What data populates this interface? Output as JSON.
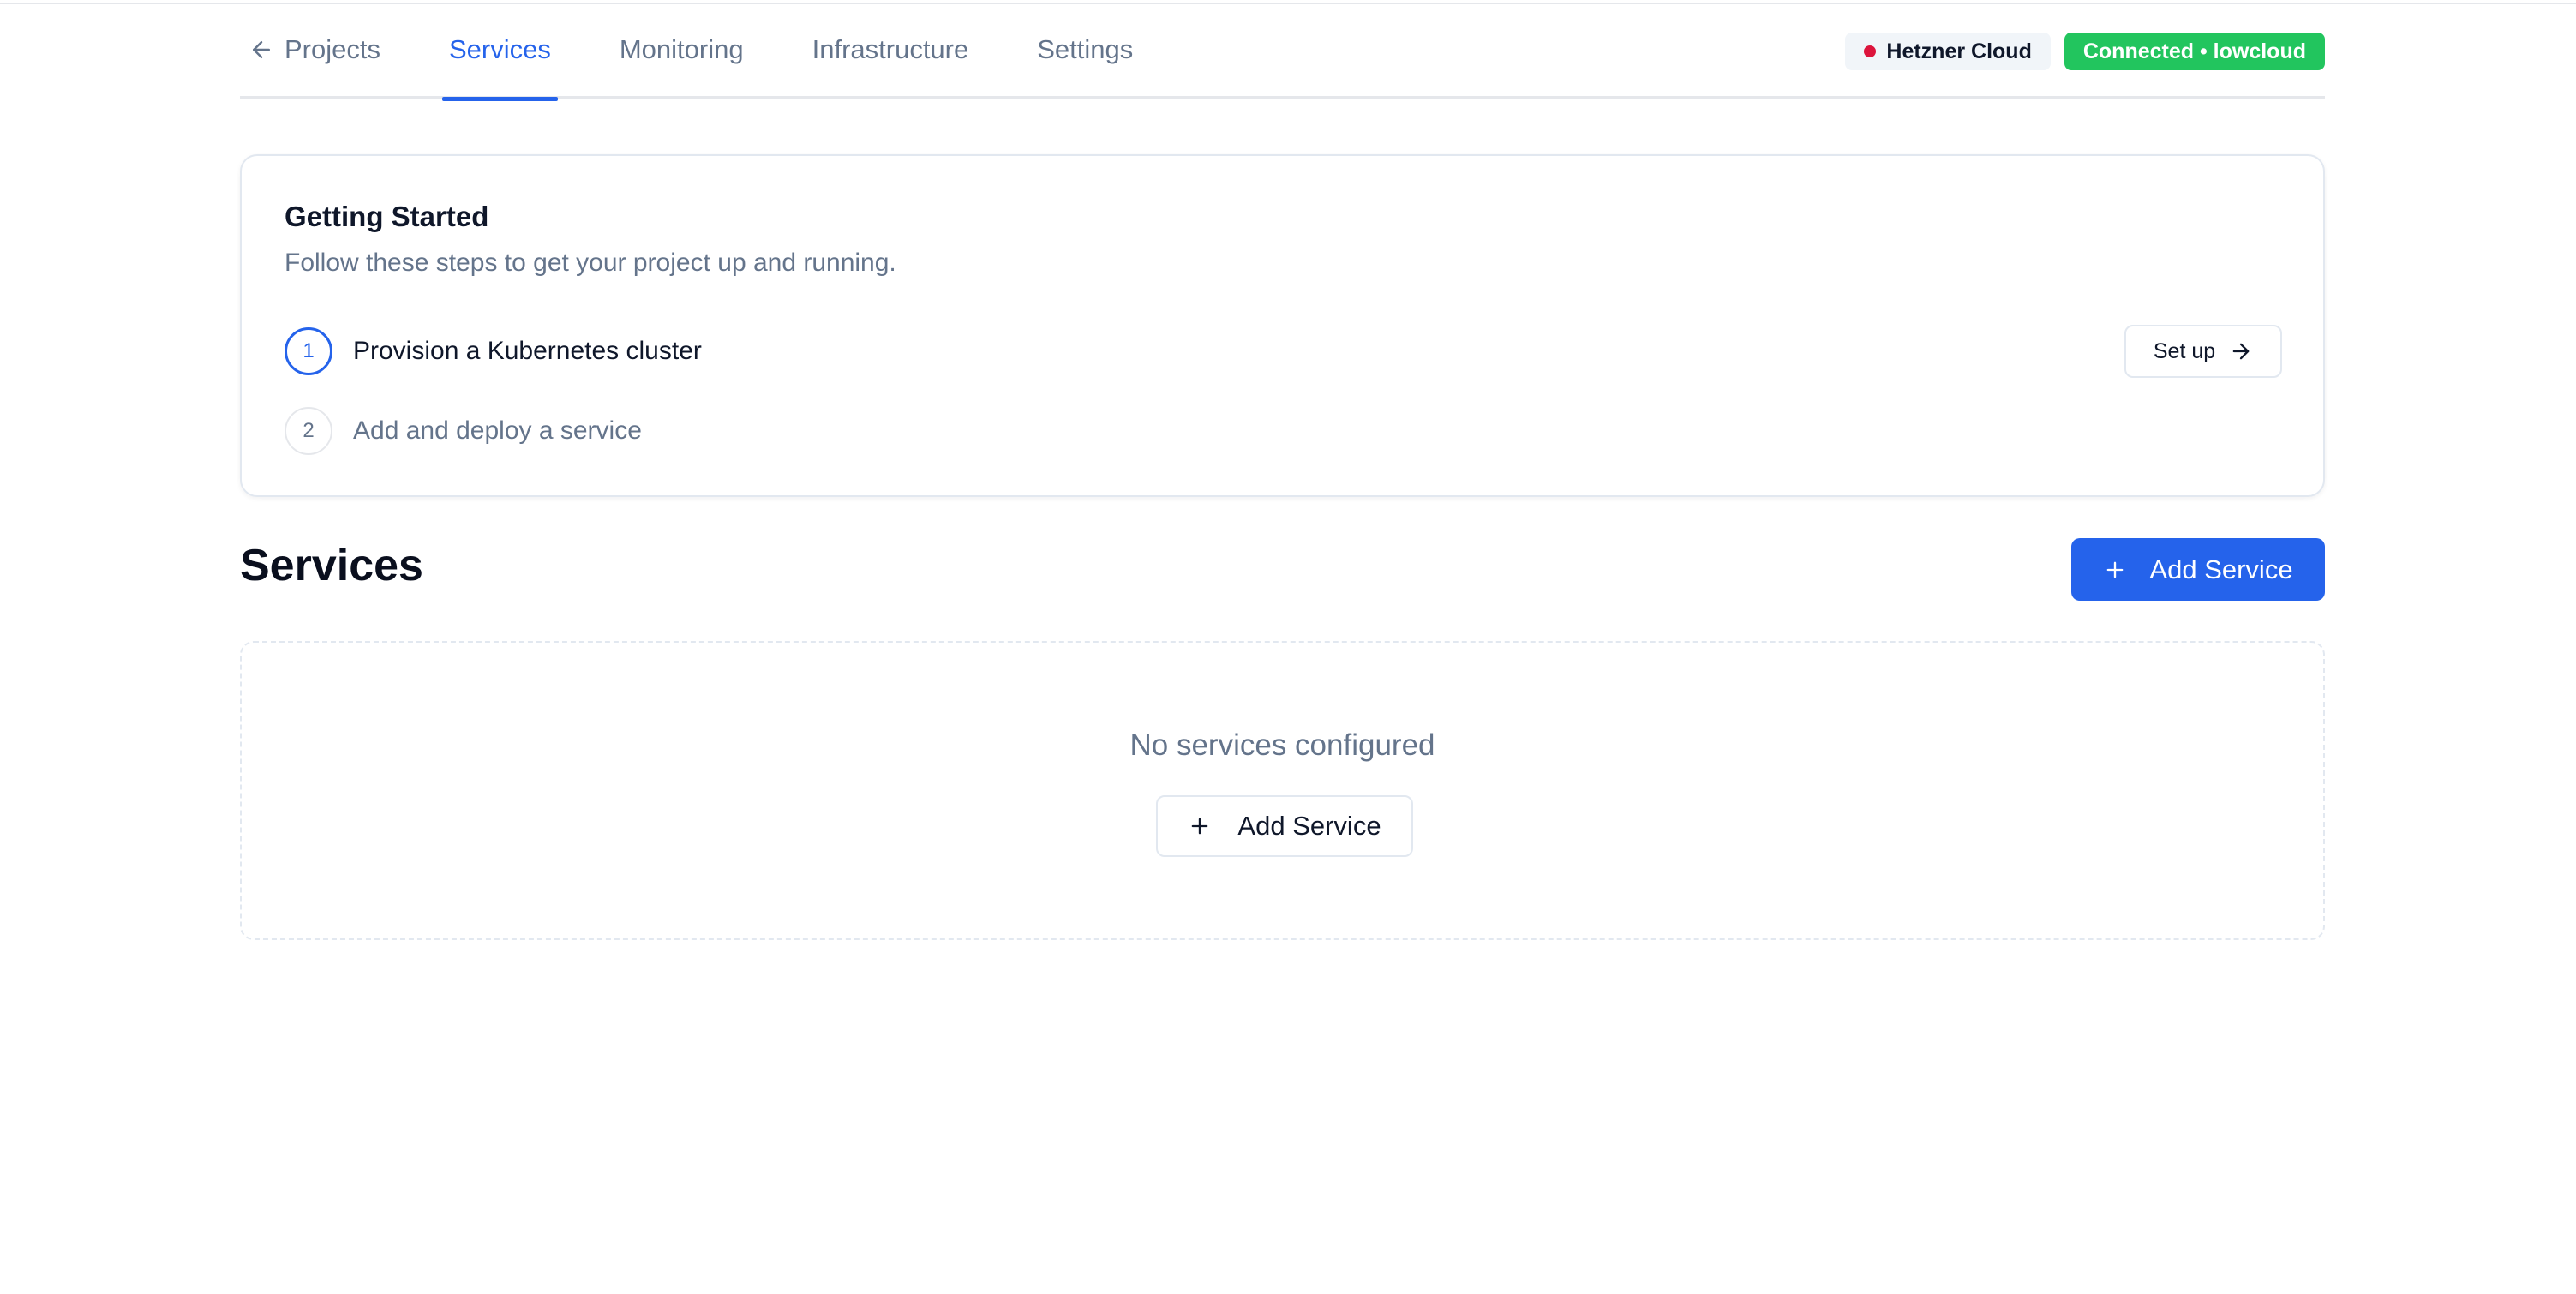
{
  "nav": {
    "tabs": [
      {
        "label": "Projects",
        "icon": "arrow-left-icon",
        "active": false
      },
      {
        "label": "Services",
        "active": true
      },
      {
        "label": "Monitoring",
        "active": false
      },
      {
        "label": "Infrastructure",
        "active": false
      },
      {
        "label": "Settings",
        "active": false
      }
    ],
    "provider_badge": "Hetzner Cloud",
    "provider_dot_color": "#dc143c",
    "status_badge": "Connected • lowcloud",
    "status_color": "#22c55e",
    "accent_color": "#2563eb"
  },
  "getting_started": {
    "title": "Getting Started",
    "subtitle": "Follow these steps to get your project up and running.",
    "steps": [
      {
        "number": "1",
        "label": "Provision a Kubernetes cluster",
        "active": true
      },
      {
        "number": "2",
        "label": "Add and deploy a service",
        "active": false
      }
    ],
    "setup_button": "Set up"
  },
  "services": {
    "title": "Services",
    "add_button": "Add Service",
    "empty_text": "No services configured",
    "empty_add_button": "Add Service"
  }
}
